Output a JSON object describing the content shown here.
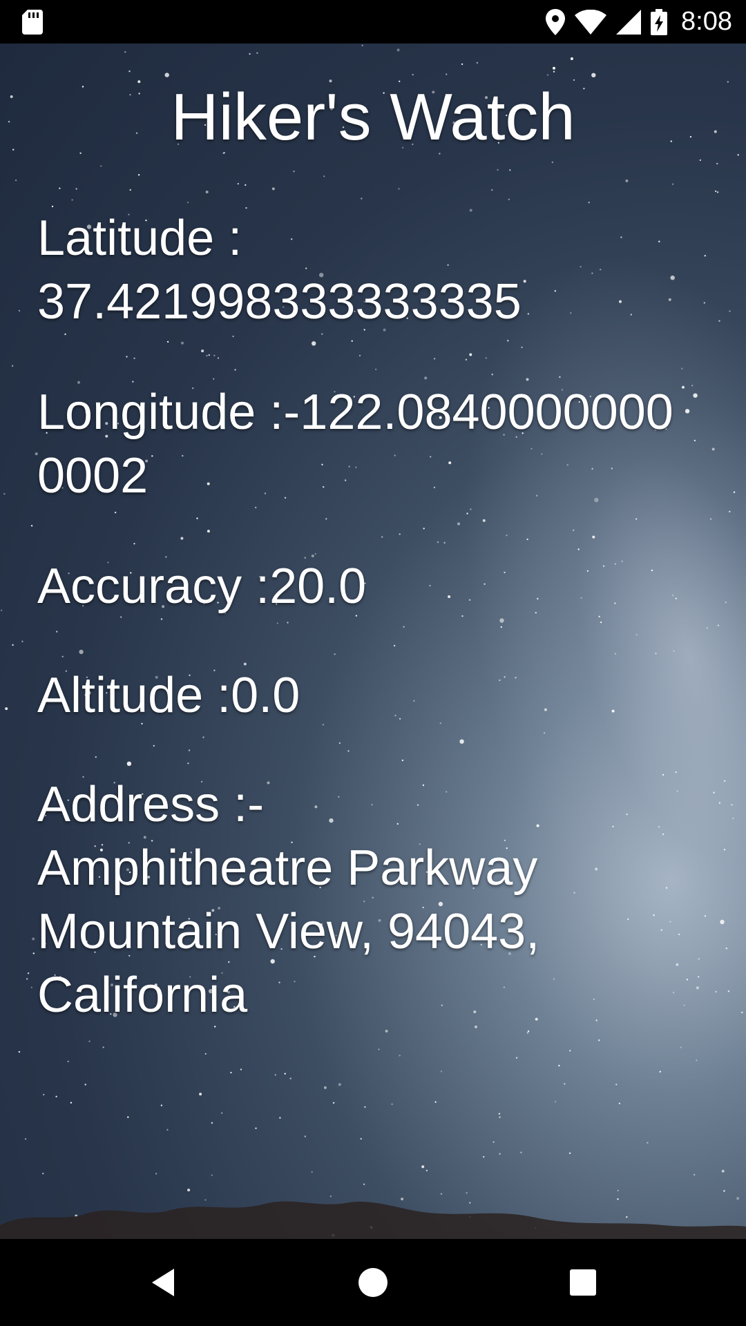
{
  "status_bar": {
    "time": "8:08",
    "icons": [
      "sd-card-icon",
      "location-icon",
      "wifi-icon",
      "signal-icon",
      "battery-charging-icon"
    ]
  },
  "app": {
    "title": "Hiker's Watch"
  },
  "location": {
    "latitude_label": "Latitude :",
    "latitude_value": "37.421998333333335",
    "longitude_text": "Longitude :-122.0840000000",
    "longitude_wrap": "0002",
    "accuracy_text": "Accuracy :20.0",
    "altitude_text": "Altitude :0.0",
    "address_label": "Address :-",
    "address_line1": "Amphitheatre Parkway",
    "address_line2": "Mountain View, 94043,",
    "address_line3": "California"
  },
  "nav_bar": {
    "buttons": [
      "back-icon",
      "home-icon",
      "recents-icon"
    ]
  },
  "colors": {
    "text": "#ffffff",
    "bars": "#000000"
  }
}
